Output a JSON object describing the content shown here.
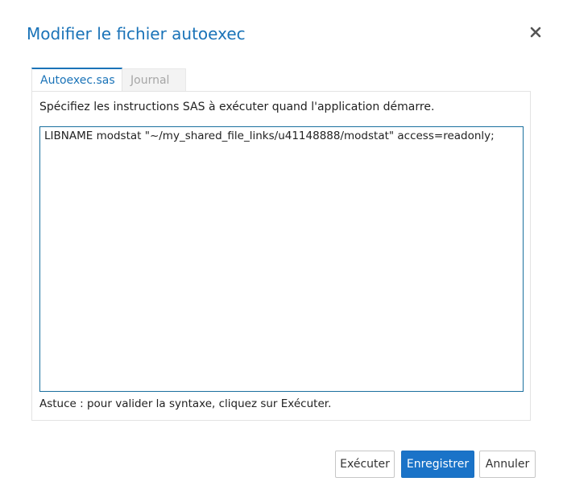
{
  "dialog": {
    "title": "Modifier le fichier autoexec",
    "close_icon": "close-icon"
  },
  "tabs": [
    {
      "label": "Autoexec.sas",
      "active": true
    },
    {
      "label": "Journal",
      "active": false
    }
  ],
  "panel": {
    "instructions": "Spécifiez les instructions SAS à exécuter quand l'application démarre.",
    "code": "LIBNAME modstat \"~/my_shared_file_links/u41148888/modstat\" access=readonly;",
    "hint": "Astuce : pour valider la syntaxe, cliquez sur Exécuter."
  },
  "buttons": {
    "run_label": "Exécuter",
    "save_label": "Enregistrer",
    "cancel_label": "Annuler"
  },
  "colors": {
    "accent": "#1a73b8",
    "primary_button": "#1a73c8"
  }
}
